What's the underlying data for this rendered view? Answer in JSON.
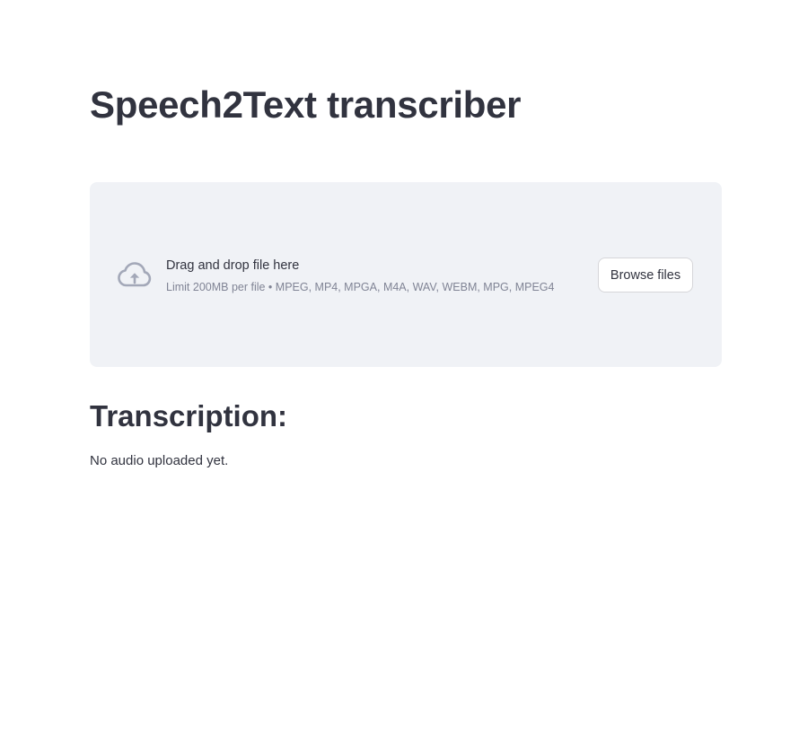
{
  "app": {
    "title": "Speech2Text transcriber"
  },
  "uploader": {
    "icon": "cloud-upload-icon",
    "drop_label": "Drag and drop file here",
    "limit_text": "Limit 200MB per file • MPEG, MP4, MPGA, M4A, WAV, WEBM, MPG, MPEG4",
    "browse_label": "Browse files"
  },
  "transcription": {
    "heading": "Transcription:",
    "status": "No audio uploaded yet."
  },
  "colors": {
    "text": "#31333f",
    "dropzone_bg": "#f0f2f6",
    "muted_text": "#808495",
    "icon": "#a3a8b8"
  }
}
